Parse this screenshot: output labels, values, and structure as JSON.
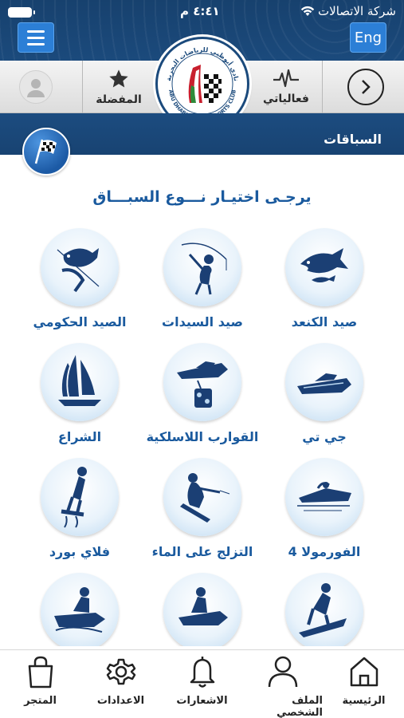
{
  "status_bar": {
    "time": "٤:٤١ م",
    "carrier": "شركة الاتصالات"
  },
  "header": {
    "language_button": "Eng"
  },
  "logo": {
    "name_ar": "نادي أبوظبي للرياضات البحرية",
    "name_en": "ABU DHABI MARINE SPORTS CLUB"
  },
  "nav": {
    "favorites_label": "المفضلة",
    "my_events_label": "فعالياتي"
  },
  "section": {
    "title": "السباقات"
  },
  "prompt": "يرجـى اختيـار نـــوع السبـــاق",
  "race_types": [
    {
      "label": "صيد الكنعد",
      "icon": "kingfish-icon"
    },
    {
      "label": "صيد السيدات",
      "icon": "ladies-fishing-icon"
    },
    {
      "label": "الصيد الحكومي",
      "icon": "government-fishing-icon"
    },
    {
      "label": "جي تي",
      "icon": "gt-boat-icon"
    },
    {
      "label": "القوارب اللاسلكية",
      "icon": "rc-boat-icon"
    },
    {
      "label": "الشراع",
      "icon": "sailing-icon"
    },
    {
      "label": "الفورمولا 4",
      "icon": "formula4-icon"
    },
    {
      "label": "التزلج على الماء",
      "icon": "water-ski-icon"
    },
    {
      "label": "فلاي بورد",
      "icon": "flyboard-icon"
    },
    {
      "label": "",
      "icon": "surfing-icon"
    },
    {
      "label": "",
      "icon": "jetski-icon"
    },
    {
      "label": "",
      "icon": "aquabike-icon"
    }
  ],
  "tabs": [
    {
      "label": "الرئيسية",
      "icon": "home-icon"
    },
    {
      "label": "الملف الشخصي",
      "icon": "profile-icon"
    },
    {
      "label": "الاشعارات",
      "icon": "bell-icon"
    },
    {
      "label": "الاعدادات",
      "icon": "gear-icon"
    },
    {
      "label": "المتجر",
      "icon": "shopping-bag-icon"
    }
  ],
  "colors": {
    "brand_navy": "#1b4a7c",
    "accent_blue": "#2c7fd6",
    "label_blue": "#1a5a9e"
  }
}
